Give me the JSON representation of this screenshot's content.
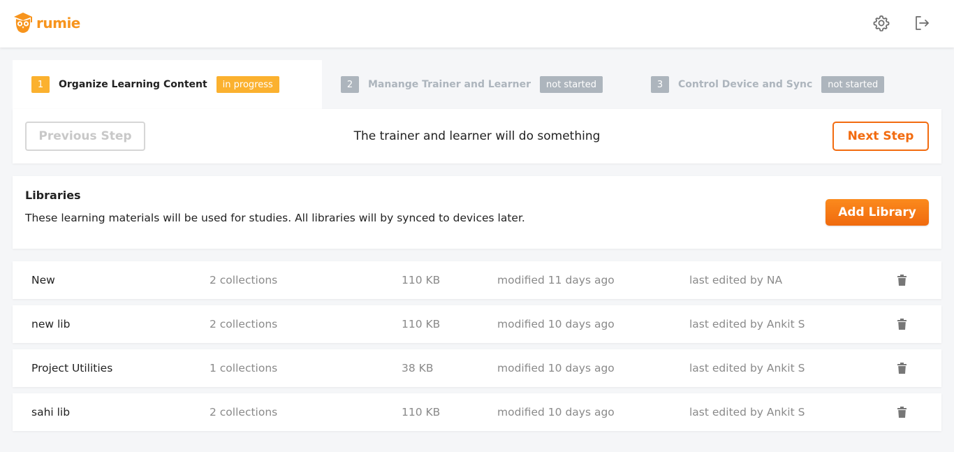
{
  "header": {
    "logo_text": "rumie",
    "settings_icon": "gear-icon",
    "logout_icon": "logout-icon",
    "brand_color": "#f7941d"
  },
  "steps": [
    {
      "number": "1",
      "label": "Organize Learning Content",
      "status": "in progress",
      "active": true
    },
    {
      "number": "2",
      "label": "Manange Trainer and Learner",
      "status": "not started",
      "active": false
    },
    {
      "number": "3",
      "label": "Control Device and Sync",
      "status": "not started",
      "active": false
    }
  ],
  "step_nav": {
    "previous_label": "Previous Step",
    "message": "The trainer and learner will do something",
    "next_label": "Next Step"
  },
  "libraries": {
    "title": "Libraries",
    "description": "These learning materials will be used for studies. All libraries will by synced to devices later.",
    "add_label": "Add Library",
    "rows": [
      {
        "name": "New",
        "collections": "2 collections",
        "size": "110 KB",
        "modified": "modified 11 days ago",
        "edited_by": "last edited by NA"
      },
      {
        "name": "new lib",
        "collections": "2 collections",
        "size": "110 KB",
        "modified": "modified 10 days ago",
        "edited_by": "last edited by Ankit S"
      },
      {
        "name": "Project Utilities",
        "collections": "1 collections",
        "size": "38 KB",
        "modified": "modified 10 days ago",
        "edited_by": "last edited by Ankit S"
      },
      {
        "name": "sahi lib",
        "collections": "2 collections",
        "size": "110 KB",
        "modified": "modified 10 days ago",
        "edited_by": "last edited by Ankit S"
      }
    ]
  },
  "colors": {
    "accent": "#f26b0f",
    "in_progress": "#fbb12f",
    "not_started": "#adb5bd",
    "muted_text": "#8a8a8a"
  }
}
